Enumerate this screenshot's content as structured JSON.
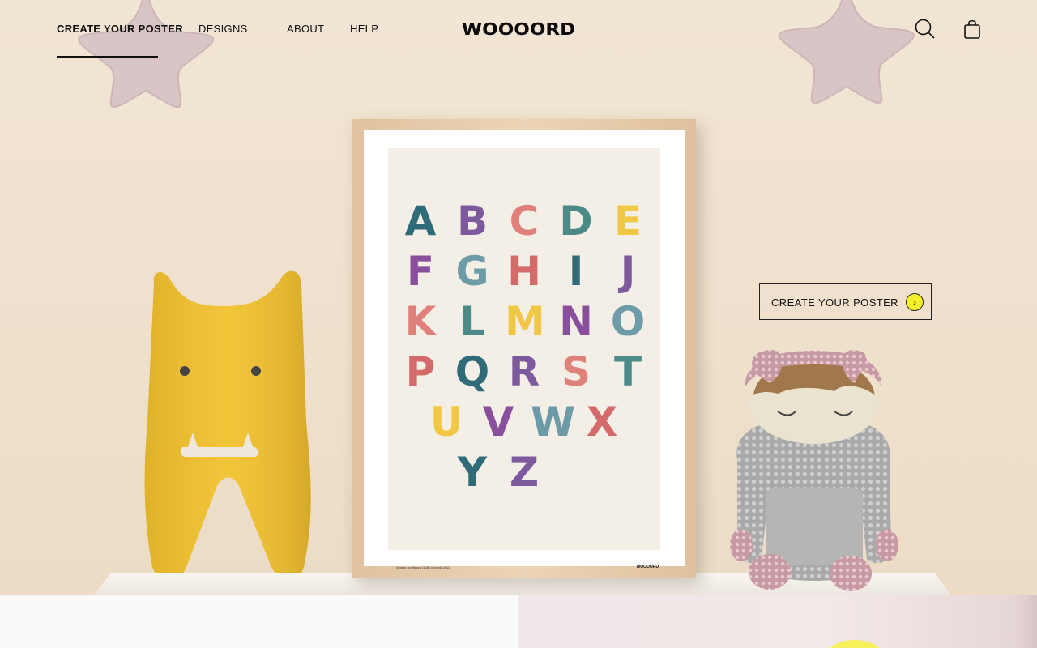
{
  "nav": {
    "items": [
      {
        "label": "CREATE YOUR POSTER",
        "active": true
      },
      {
        "label": "DESIGNS",
        "active": false
      },
      {
        "label": "ABOUT",
        "active": false
      },
      {
        "label": "HELP",
        "active": false
      }
    ]
  },
  "brand": {
    "logo_text": "WOOOORD"
  },
  "icons": {
    "search": "search-icon",
    "cart": "shopping-bag-icon",
    "cta_arrow": "chevron-right-icon"
  },
  "hero": {
    "cta_label": "CREATE YOUR POSTER",
    "cta_arrow": "›"
  },
  "poster": {
    "letters": [
      "A",
      "B",
      "C",
      "D",
      "E",
      "F",
      "G",
      "H",
      "I",
      "J",
      "K",
      "L",
      "M",
      "N",
      "O",
      "P",
      "Q",
      "R",
      "S",
      "T",
      "U",
      "V",
      "W",
      "X",
      "Y",
      "Z"
    ],
    "credit": "Design by: Beyza Gülbi Çeçevik",
    "year": "2022",
    "logo": "WOOOORD"
  },
  "colors": {
    "accent_yellow": "#f3f02a",
    "background": "#efe2d0",
    "text": "#111111"
  }
}
